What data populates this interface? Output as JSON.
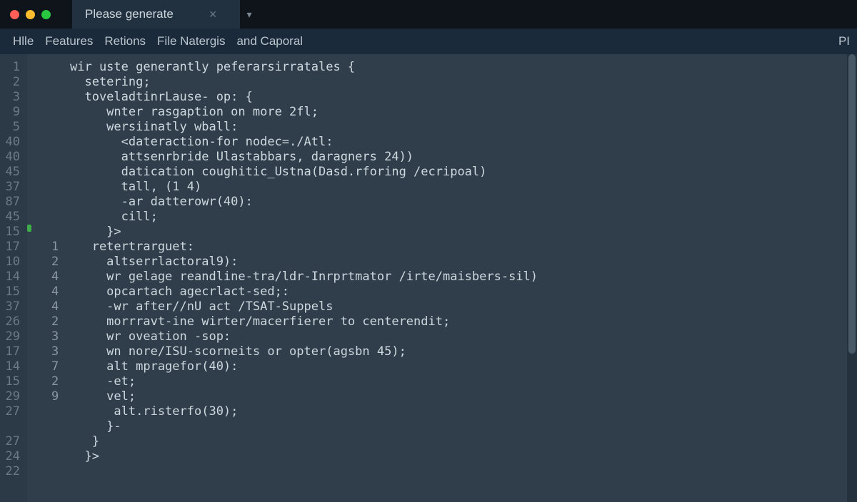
{
  "titlebar": {
    "tab_label": "Please generate",
    "close_glyph": "×",
    "new_tab_glyph": "▾"
  },
  "menu": {
    "items": [
      "Hlle",
      "Features",
      "Retions",
      "File Natergis",
      "and Caporal"
    ],
    "right": "PI"
  },
  "gutter_left": [
    "1",
    "2",
    "3",
    "9",
    "5",
    "40",
    "40",
    "45",
    "37",
    "87",
    "45",
    "15",
    "17",
    "10",
    "14",
    "15",
    "37",
    "26",
    "29",
    "17",
    "14",
    "15",
    "29",
    "27",
    "",
    "27",
    "24",
    "22"
  ],
  "gutter_sub": [
    "",
    "",
    "",
    "",
    "",
    "",
    "",
    "",
    "",
    "",
    "",
    "",
    "1",
    "2",
    "4",
    "4",
    "4",
    "2",
    "3",
    "3",
    "7",
    "2",
    "9",
    "",
    "",
    "",
    "",
    ""
  ],
  "code_lines": [
    "wir uste generantly peferarsirratales {",
    "  setering;",
    "  toveladtinrLause- op: {",
    "     wnter rasgaption on more 2fl;",
    "     wersiinatly wball:",
    "       <dateraction-for nodec=./Atl:",
    "       attsenrbride Ulastabbars, daragners 24))",
    "       datication coughitic_Ustna(Dasd.rforing /ecripoal)",
    "       tall, (1 4)",
    "       -ar datterowr(40):",
    "       cill;",
    "     }>",
    "   retertrarguet:",
    "     altserrlactoral9):",
    "     wr gelage reandline-tra/ldr-Inrprtmator /irte/maisbers-sil)",
    "     opcartach agecrlact-sed;:",
    "     -wr after//nU act /TSAT-Suppels",
    "     morrravt-ine wirter/macerfierer to centerendit;",
    "     wr oveation -sop:",
    "     wn nore/ISU-scorneits or opter(agsbn 45);",
    "     alt mpragefor(40):",
    "     -et;",
    "     vel;",
    "      alt.risterfo(30);",
    "     }-",
    "   }",
    "  }>",
    ""
  ]
}
